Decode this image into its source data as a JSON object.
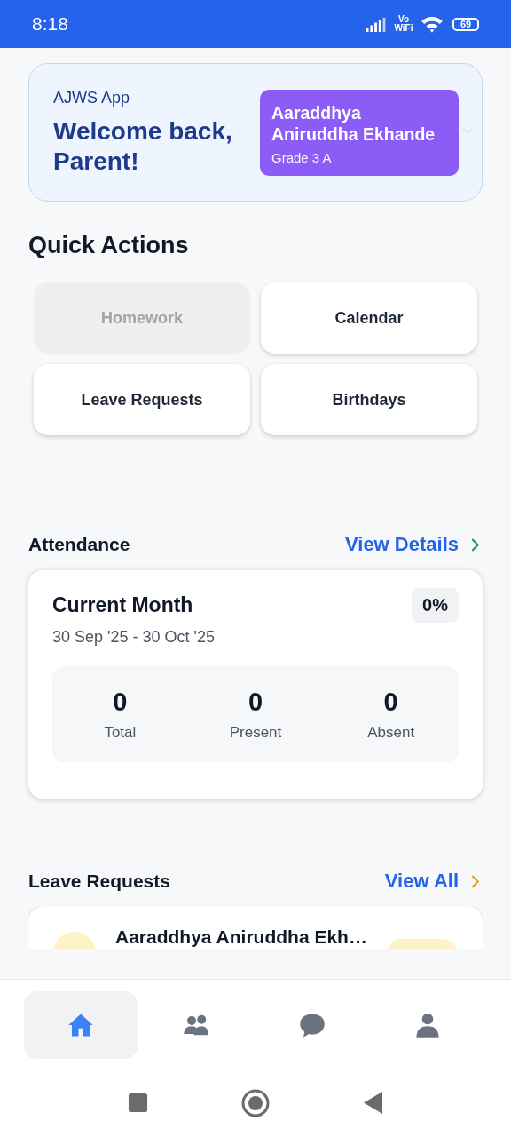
{
  "status_bar": {
    "time": "8:18",
    "network_label": "Vo WiFi",
    "battery": "69"
  },
  "header": {
    "app_name": "AJWS App",
    "greeting": "Welcome back, Parent!",
    "student": {
      "name": "Aaraddhya Aniruddha Ekhande",
      "class": "Grade 3 A"
    }
  },
  "quick_actions": {
    "title": "Quick Actions",
    "items": [
      {
        "label": "Homework",
        "disabled": true
      },
      {
        "label": "Calendar",
        "disabled": false
      },
      {
        "label": "Leave Requests",
        "disabled": false
      },
      {
        "label": "Birthdays",
        "disabled": false
      }
    ]
  },
  "attendance": {
    "title": "Attendance",
    "link": "View Details",
    "card": {
      "title": "Current Month",
      "percent": "0%",
      "range": "30 Sep '25 - 30 Oct '25",
      "stats": [
        {
          "value": "0",
          "label": "Total"
        },
        {
          "value": "0",
          "label": "Present"
        },
        {
          "value": "0",
          "label": "Absent"
        }
      ]
    }
  },
  "leave_requests": {
    "title": "Leave Requests",
    "link": "View All",
    "items": [
      {
        "name": "Aaraddhya Aniruddha Ekh…"
      }
    ]
  },
  "bottom_nav": {
    "items": [
      {
        "kind": "home",
        "selected": true
      },
      {
        "kind": "people",
        "selected": false
      },
      {
        "kind": "chat",
        "selected": false
      },
      {
        "kind": "profile",
        "selected": false
      }
    ]
  }
}
